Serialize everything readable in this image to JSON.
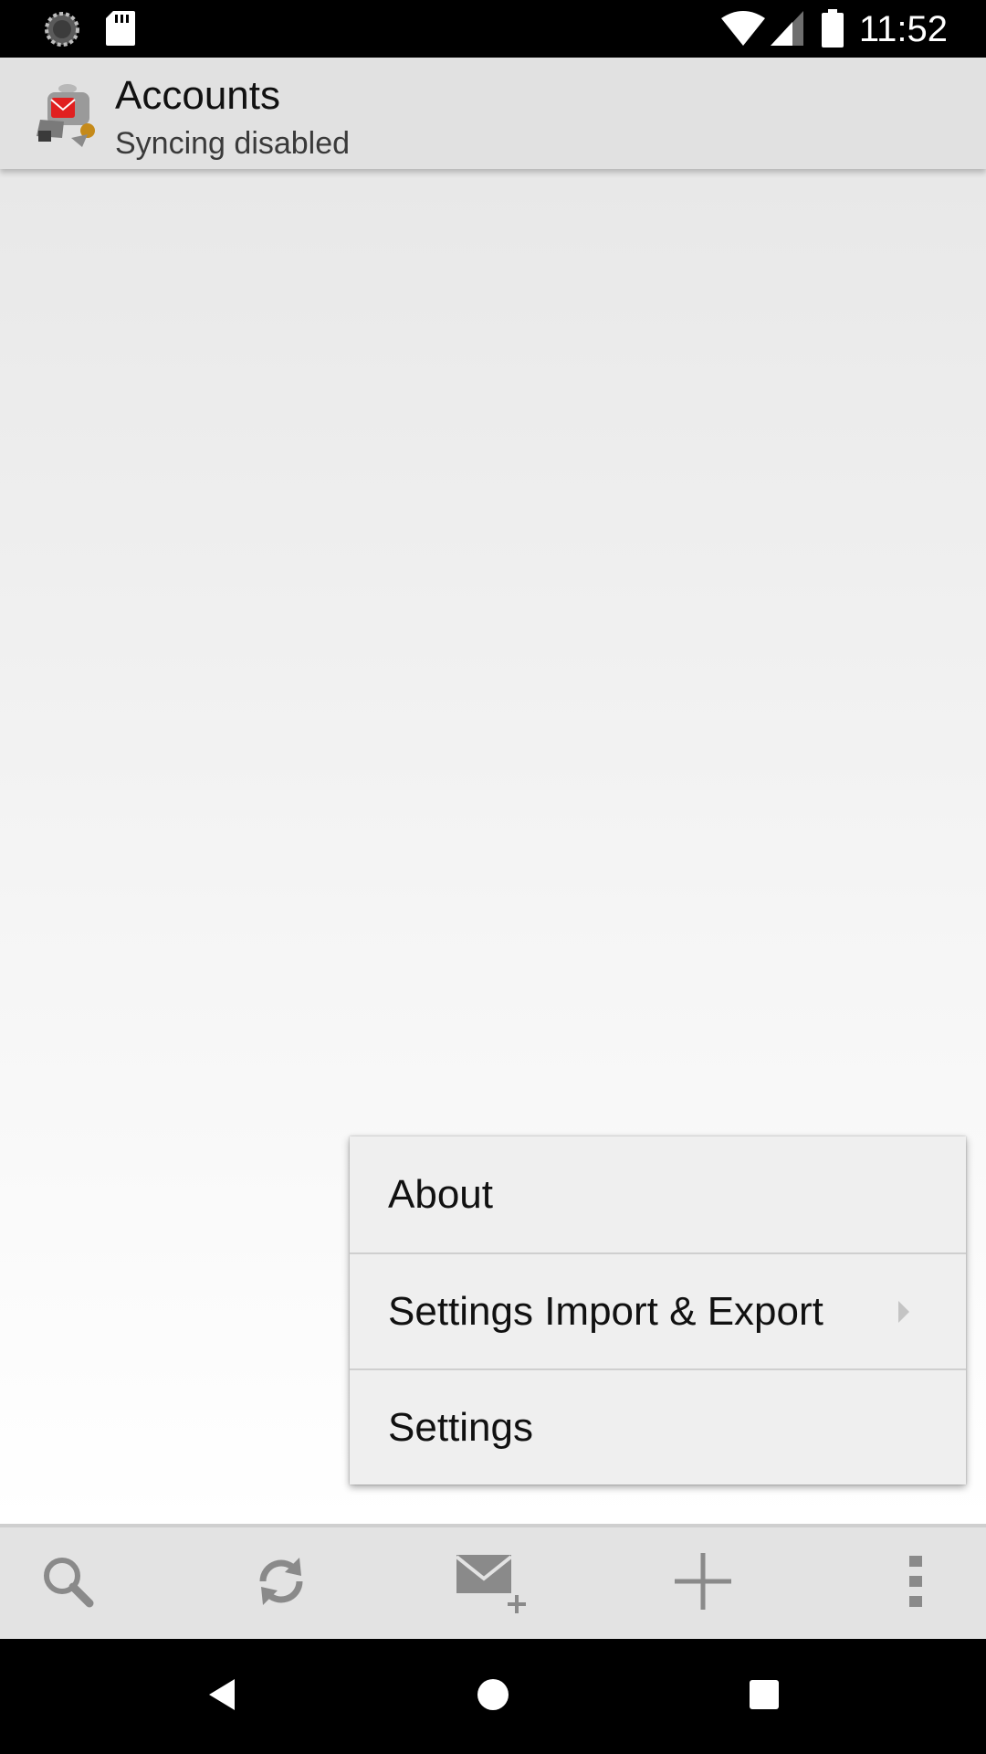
{
  "status_bar": {
    "time": "11:52",
    "icons": [
      "loading-spinner-icon",
      "sd-card-icon",
      "wifi-icon",
      "cell-signal-icon",
      "battery-icon"
    ]
  },
  "action_bar": {
    "title": "Accounts",
    "subtitle": "Syncing disabled",
    "app_icon": "k9-mail-app-icon"
  },
  "popup_menu": {
    "items": [
      {
        "label": "About",
        "has_submenu": false
      },
      {
        "label": "Settings Import & Export",
        "has_submenu": true
      },
      {
        "label": "Settings",
        "has_submenu": false
      }
    ]
  },
  "bottom_toolbar": {
    "buttons": [
      "search-icon",
      "refresh-icon",
      "compose-icon",
      "add-icon",
      "overflow-menu-icon"
    ]
  },
  "nav_bar": {
    "buttons": [
      "back-icon",
      "home-icon",
      "recents-icon"
    ]
  },
  "colors": {
    "status_bar": "#000000",
    "action_bar": "#e1e1e1",
    "menu_background": "#efefef",
    "toolbar": "#e3e3e3",
    "icon_gray": "#8a8a8a"
  }
}
